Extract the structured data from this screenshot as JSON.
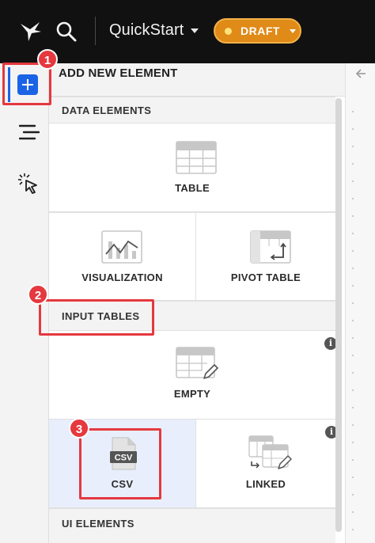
{
  "topbar": {
    "workbook_title": "QuickStart",
    "status_label": "DRAFT",
    "logo_icon": "sigma-bird-logo-icon",
    "search_icon": "search-icon"
  },
  "rail": {
    "items": [
      {
        "icon": "plus-square-icon",
        "active": true
      },
      {
        "icon": "outline-list-icon",
        "active": false
      },
      {
        "icon": "pointer-click-icon",
        "active": false
      }
    ]
  },
  "panel": {
    "title": "ADD NEW ELEMENT",
    "sections": {
      "data_elements": {
        "label": "DATA ELEMENTS",
        "items": {
          "table": "TABLE",
          "visualization": "VISUALIZATION",
          "pivot_table": "PIVOT TABLE"
        }
      },
      "input_tables": {
        "label": "INPUT TABLES",
        "items": {
          "empty": "EMPTY",
          "csv": "CSV",
          "linked": "LINKED"
        },
        "info_glyph": "i"
      },
      "ui_elements": {
        "label": "UI ELEMENTS"
      }
    },
    "csv_icon_text": "CSV"
  },
  "annotations": {
    "badges": [
      "1",
      "2",
      "3"
    ]
  },
  "colors": {
    "accent": "#1b63e6",
    "draft": "#e08a17",
    "annotation": "#e5383f",
    "selected_tile": "#e8eefb"
  }
}
